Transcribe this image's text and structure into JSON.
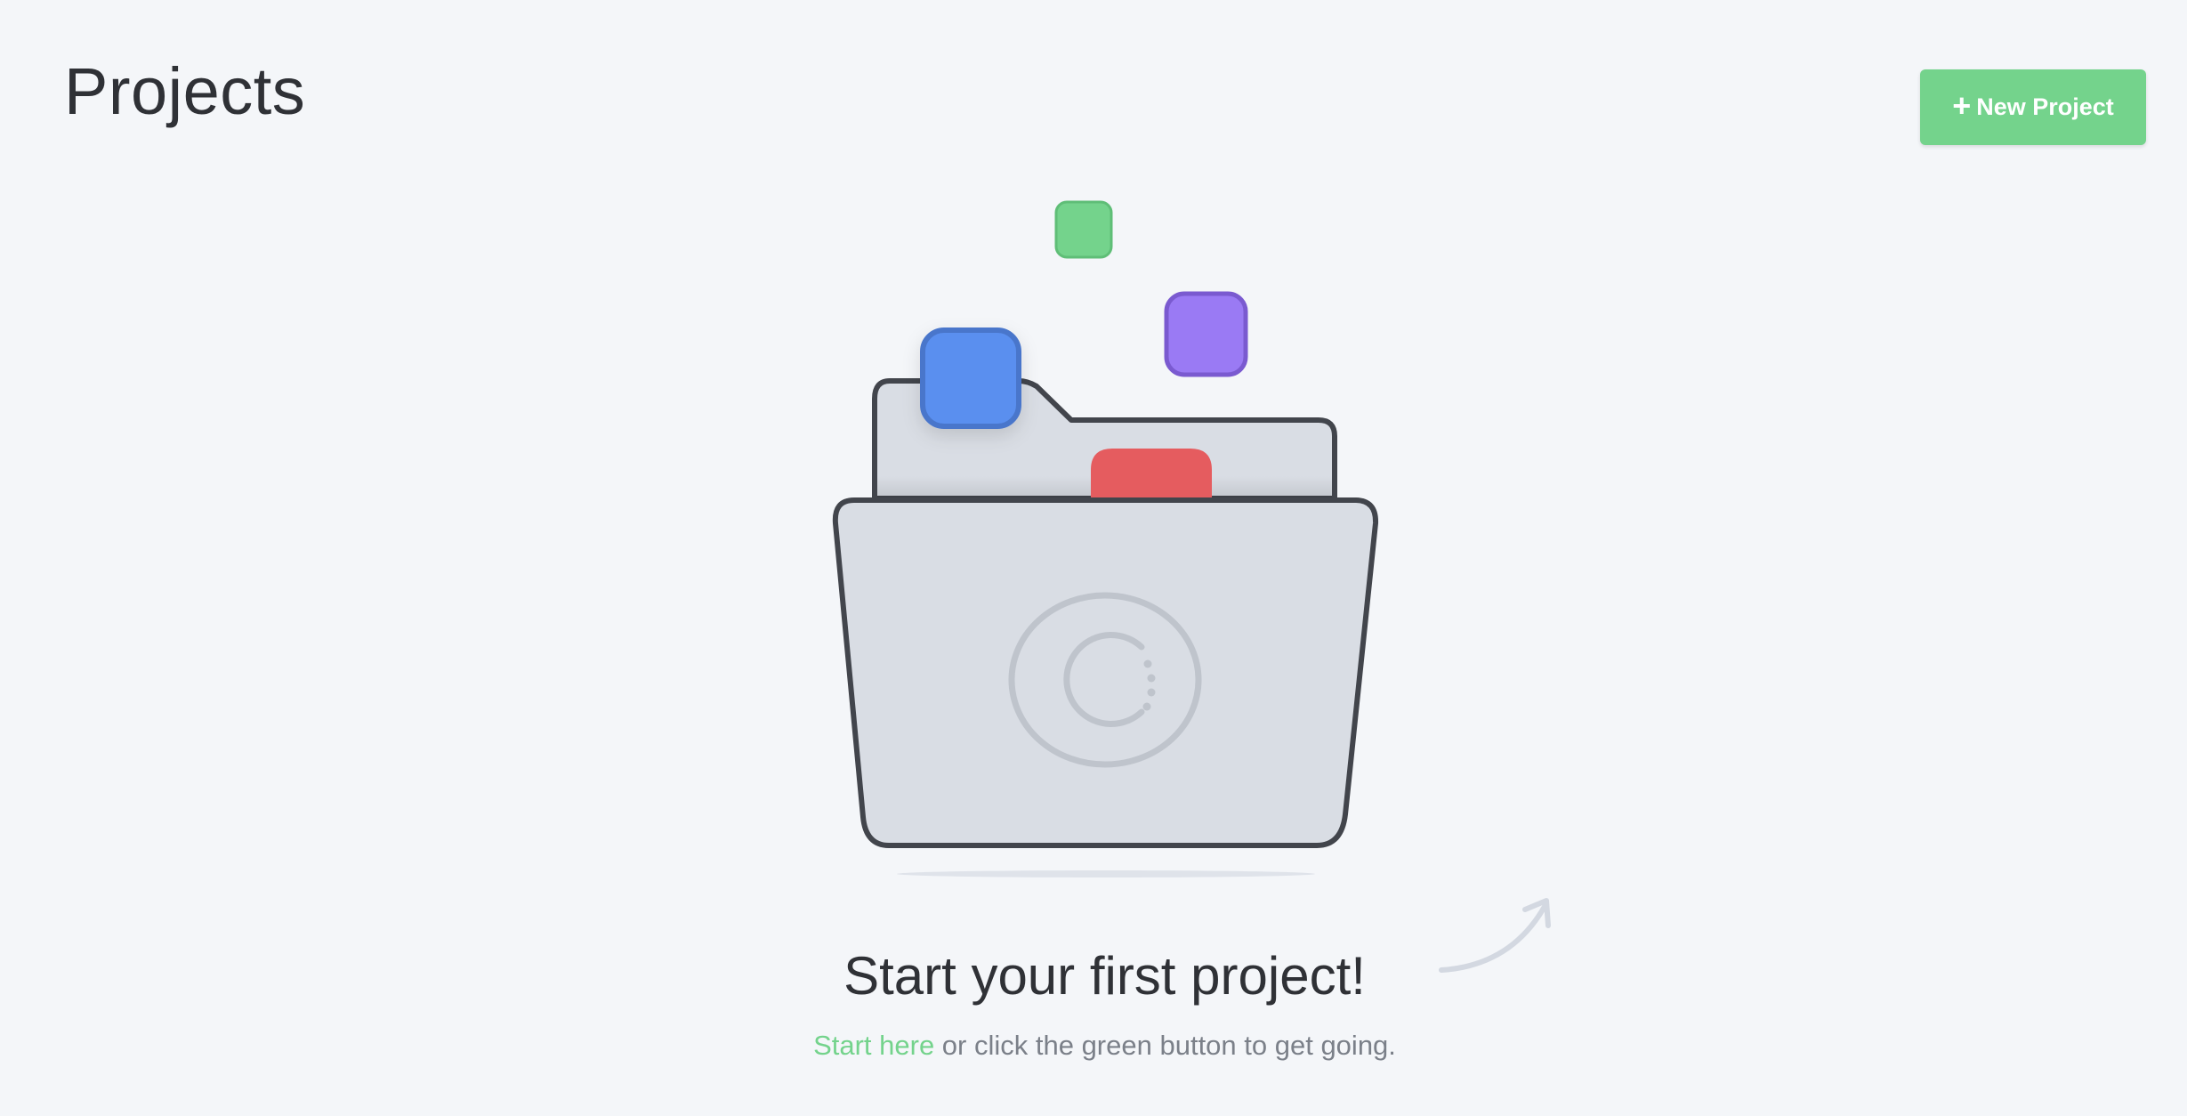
{
  "header": {
    "title": "Projects",
    "new_project_label": "New Project",
    "new_project_icon": "+"
  },
  "empty_state": {
    "heading": "Start your first project!",
    "link_text": "Start here",
    "rest_text": " or click the green button to get going."
  },
  "colors": {
    "background": "#f4f6f9",
    "accent_green": "#74d38c",
    "tile_blue": "#5a8fef",
    "tile_purple": "#9a7af4",
    "tile_red": "#e55c5f",
    "folder_fill": "#d9dde4",
    "folder_stroke": "#42454c"
  },
  "icons": {
    "illustration": "folder-icon",
    "arrow": "curved-arrow-icon",
    "logo": "circle-logo-icon"
  }
}
